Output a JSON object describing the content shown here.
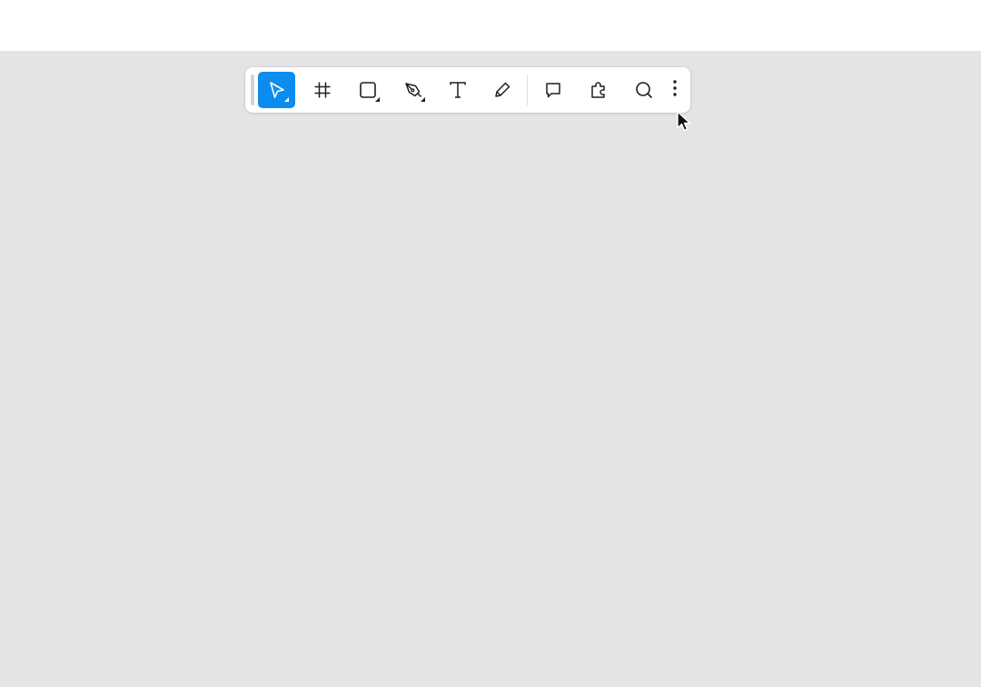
{
  "toolbar": {
    "tools": [
      {
        "name": "move",
        "icon": "move-cursor-icon",
        "active": true,
        "has_menu": true
      },
      {
        "name": "frame",
        "icon": "frame-hash-icon",
        "active": false,
        "has_menu": false
      },
      {
        "name": "shape",
        "icon": "rectangle-icon",
        "active": false,
        "has_menu": true
      },
      {
        "name": "pen",
        "icon": "pen-tool-icon",
        "active": false,
        "has_menu": true
      },
      {
        "name": "text",
        "icon": "text-t-icon",
        "active": false,
        "has_menu": false
      },
      {
        "name": "pencil",
        "icon": "pencil-icon",
        "active": false,
        "has_menu": false
      },
      {
        "name": "comment",
        "icon": "comment-bubble-icon",
        "active": false,
        "has_menu": false
      },
      {
        "name": "plugins",
        "icon": "puzzle-piece-icon",
        "active": false,
        "has_menu": false
      },
      {
        "name": "search",
        "icon": "search-icon",
        "active": false,
        "has_menu": false
      }
    ],
    "more_icon": "vertical-ellipsis-icon"
  },
  "colors": {
    "accent": "#0d8cf0",
    "canvas": "#e4e4e6",
    "toolbar_bg": "#ffffff",
    "icon": "#1e1e1e"
  }
}
